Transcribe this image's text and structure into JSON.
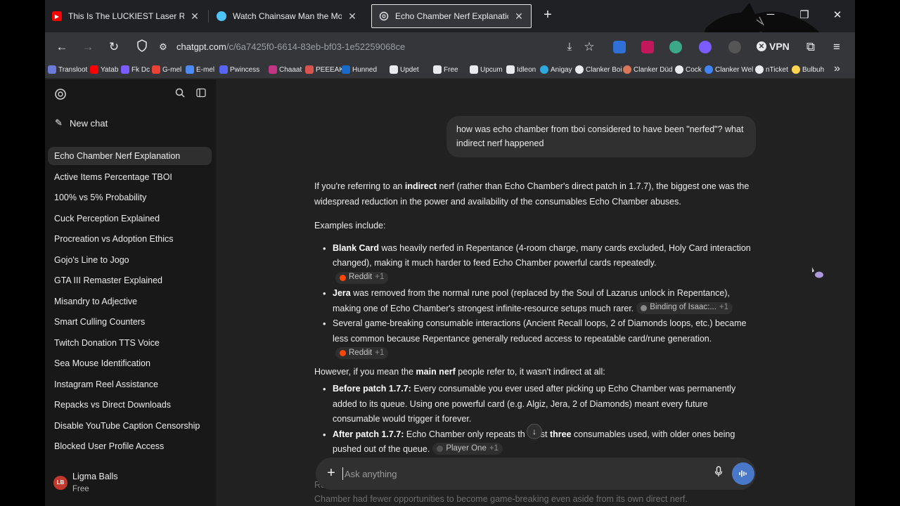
{
  "browser": {
    "tabs": [
      {
        "title": "This Is The LUCKIEST Laser Run - YouTube",
        "icon": "youtube-icon",
        "color": "#ff0000"
      },
      {
        "title": "Watch Chainsaw Man the Movie: Reze Arc",
        "icon": "globe-icon",
        "color": "#4fc3f7"
      },
      {
        "title": "Echo Chamber Nerf Explanation",
        "icon": "chatgpt-icon",
        "color": "#e8eaed"
      }
    ],
    "url_host": "chatgpt.com",
    "url_path": "/c/6a7425f0-6614-83eb-bf03-1e52259068ce",
    "vpn_label": "VPN",
    "bookmarks": [
      {
        "label": "Transloot",
        "color": "#6d7bd8"
      },
      {
        "label": "Yatab",
        "color": "#ff0000"
      },
      {
        "label": "Fk Dc",
        "color": "#7a5cff"
      },
      {
        "label": "G-mel",
        "color": "#ea4335"
      },
      {
        "label": "E-mel",
        "color": "#4c8bf5"
      },
      {
        "label": "Pwincess",
        "color": "#5865f2"
      },
      {
        "label": "Chaaat",
        "color": "#c13584"
      },
      {
        "label": "PEEEAK",
        "color": "#d9534f"
      },
      {
        "label": "Hunned",
        "color": "#1b6ac9"
      },
      {
        "label": "Updet",
        "color": "#e8eaed"
      },
      {
        "label": "Free",
        "color": "#e8eaed"
      },
      {
        "label": "Upcum",
        "color": "#e8eaed"
      },
      {
        "label": "Idleon",
        "color": "#e8eaed"
      },
      {
        "label": "Anigay",
        "color": "#2fa8e0"
      },
      {
        "label": "Clanker Boi",
        "color": "#e8eaed"
      },
      {
        "label": "Clanker Düd",
        "color": "#d97757"
      },
      {
        "label": "Cock",
        "color": "#e8eaed"
      },
      {
        "label": "Clanker Wel",
        "color": "#4285f4"
      },
      {
        "label": "nTicket",
        "color": "#e8eaed"
      },
      {
        "label": "Bulbuh",
        "color": "#ffd54f"
      }
    ]
  },
  "sidebar": {
    "new_chat": "New chat",
    "chats": [
      "Echo Chamber Nerf Explanation",
      "Active Items Percentage TBOI",
      "100% vs 5% Probability",
      "Cuck Perception Explained",
      "Procreation vs Adoption Ethics",
      "Gojo's Line to Jogo",
      "GTA III Remaster Explained",
      "Misandry to Adjective",
      "Smart Culling Counters",
      "Twitch Donation TTS Voice",
      "Sea Mouse Identification",
      "Instagram Reel Assistance",
      "Repacks vs Direct Downloads",
      "Disable YouTube Caption Censorship",
      "Blocked User Profile Access"
    ],
    "user": {
      "initials": "LB",
      "name": "Ligma Balls",
      "plan": "Free"
    }
  },
  "conversation": {
    "user_message": "how was echo chamber from tboi considered to have been \"nerfed\"? what indirect nerf happened",
    "intro_1": "If you're referring to an ",
    "intro_bold": "indirect",
    "intro_2": " nerf (rather than Echo Chamber's direct patch in 1.7.7), the biggest one was the widespread reduction in the power and availability of the consumables Echo Chamber abuses.",
    "examples_label": "Examples include:",
    "bullet1_bold": "Blank Card",
    "bullet1_text": " was heavily nerfed in Repentance (4-room charge, many cards excluded, Holy Card interaction changed), making it much harder to feed Echo Chamber powerful cards repeatedly.",
    "bullet1_cite": "Reddit",
    "bullet1_cite_more": "+1",
    "bullet2_bold": "Jera",
    "bullet2_text": " was removed from the normal rune pool (replaced by the Soul of Lazarus unlock in Repentance), making one of Echo Chamber's strongest infinite-resource setups much rarer.",
    "bullet2_cite": "Binding of Isaac:...",
    "bullet2_cite_more": "+1",
    "bullet3_text": "Several game-breaking consumable interactions (Ancient Recall loops, 2 of Diamonds loops, etc.) became less common because Repentance generally reduced access to repeatable card/rune generation.",
    "bullet3_cite": "Reddit",
    "bullet3_cite_more": "+1",
    "however_1": "However, if you mean the ",
    "however_bold": "main nerf",
    "however_2": " people refer to, it wasn't indirect at all:",
    "bullet4_bold": "Before patch 1.7.7:",
    "bullet4_text": " Every consumable you ever used after picking up Echo Chamber was permanently added to its queue. Using one powerful card (e.g. Algiz, Jera, 2 of Diamonds) meant every future consumable would trigger it forever.",
    "bullet5_bold": "After patch 1.7.7:",
    "bullet5_text_1": " Echo Chamber only repeats th",
    "bullet5_text_2": "st ",
    "bullet5_bold2": "three",
    "bullet5_text_3": " consumables used, with older ones being pushed out of the queue.",
    "bullet5_cite": "Player One",
    "bullet5_cite_more": "+1",
    "faded_prefix": "Re",
    "faded_line": "Chamber had fewer opportunities to become game-breaking even aside from its own direct nerf."
  },
  "composer": {
    "placeholder": "Ask anything"
  }
}
